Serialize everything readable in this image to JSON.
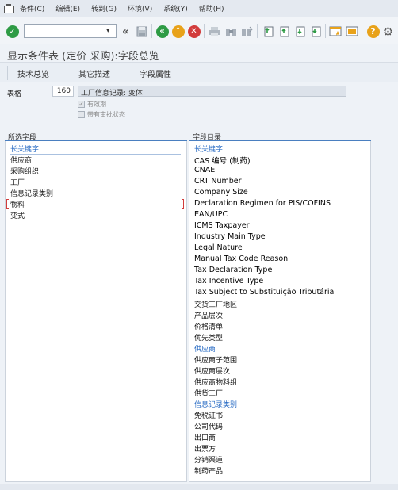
{
  "menubar": {
    "items": [
      "条件(C)",
      "编辑(E)",
      "转到(G)",
      "环境(V)",
      "系统(Y)",
      "帮助(H)"
    ]
  },
  "toolbar": {
    "command_field_value": "",
    "icons": [
      "check-icon",
      "command-field",
      "back-nav-icon",
      "save-icon",
      "back-icon",
      "exit-icon",
      "cancel-icon",
      "print-icon",
      "find-icon",
      "find-next-icon",
      "first-page-icon",
      "prev-page-icon",
      "next-page-icon",
      "last-page-icon",
      "new-session-icon",
      "shortcut-icon",
      "help-icon",
      "settings-icon"
    ],
    "colors": {
      "check": "#2e9b45",
      "back": "#2e9b45",
      "exit": "#e8a21a",
      "cancel": "#d23c3c",
      "help": "#e8a21a"
    }
  },
  "page": {
    "title": "显示条件表 (定价 采购):字段总览"
  },
  "tabs": [
    "技术总览",
    "其它描述",
    "字段属性"
  ],
  "header": {
    "table_label": "表格",
    "table_number": "160",
    "table_description": "工厂信息记录: 变体",
    "checkbox_valid": "有效期",
    "checkbox_release": "带有审批状态",
    "checkbox_valid_checked": true,
    "checkbox_release_checked": false
  },
  "selected_fields": {
    "heading": "所选字段",
    "items": [
      "长关键字",
      "供应商",
      "采购组织",
      "工厂",
      "信息记录类别",
      "物料",
      "变式"
    ]
  },
  "field_catalog": {
    "heading": "字段目录",
    "items": [
      "长关键字",
      "CAS 编号 (制药)",
      "CNAE",
      "CRT Number",
      "Company Size",
      "Declaration Regimen for PIS/COFINS",
      "EAN/UPC",
      "ICMS Taxpayer",
      "Industry Main Type",
      "Legal Nature",
      "Manual Tax Code Reason",
      "Tax Declaration Type",
      "Tax Incentive Type",
      "Tax Subject to Substituição Tributária",
      "交货工厂地区",
      "产品层次",
      "价格清单",
      "优先类型",
      "供应商",
      "供应商子范围",
      "供应商层次",
      "供应商物料组",
      "供货工厂",
      "信息记录类别",
      "免税证书",
      "公司代码",
      "出口商",
      "出票方",
      "分销渠道",
      "制药产品"
    ]
  }
}
